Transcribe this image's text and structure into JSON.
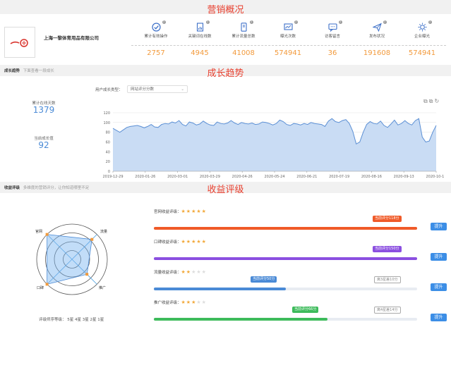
{
  "sections": {
    "overview_title": "营销概况",
    "growth_title": "成长趋势",
    "revenue_title": "收益评级"
  },
  "company": {
    "name": "上海一黎体育用品有限公司"
  },
  "stats": [
    {
      "label": "累计有效操作",
      "value": "2757",
      "icon": "check-circle-icon"
    },
    {
      "label": "关键词在线数",
      "value": "4945",
      "icon": "document-icon"
    },
    {
      "label": "累计流量总数",
      "value": "41008",
      "icon": "phone-icon"
    },
    {
      "label": "曝光次数",
      "value": "574941",
      "icon": "monitor-chart-icon"
    },
    {
      "label": "访客留言",
      "value": "36",
      "icon": "message-icon"
    },
    {
      "label": "发布状况",
      "value": "191608",
      "icon": "paper-plane-icon"
    },
    {
      "label": "企业曝光",
      "value": "574941",
      "icon": "sun-icon"
    }
  ],
  "growth": {
    "tab_label": "成长趋势",
    "tab_hint": "下面查看一段成长",
    "type_label": "用户成长类型：",
    "type_value": "网站评分分数",
    "cumulative_label": "累计在线天数",
    "cumulative_value": "1379",
    "current_label": "当前成长值",
    "current_value": "92"
  },
  "chart_data": {
    "type": "area",
    "x_ticks": [
      "2019-12-29",
      "2020-01-26",
      "2020-03-01",
      "2020-03-29",
      "2020-04-26",
      "2020-05-24",
      "2020-06-21",
      "2020-07-19",
      "2020-08-16",
      "2020-09-13",
      "2020-10-11"
    ],
    "y_ticks": [
      "0",
      "20",
      "40",
      "60",
      "80",
      "100",
      "120"
    ],
    "ylim": [
      0,
      120
    ],
    "grid": true,
    "color": "#5b8fd4",
    "fill": "#c9dcf4",
    "values": [
      88,
      84,
      80,
      85,
      90,
      92,
      93,
      94,
      92,
      89,
      92,
      96,
      91,
      90,
      96,
      98,
      97,
      101,
      99,
      104,
      96,
      93,
      101,
      99,
      95,
      97,
      103,
      98,
      95,
      94,
      101,
      98,
      97,
      99,
      104,
      99,
      96,
      100,
      98,
      97,
      99,
      96,
      97,
      101,
      100,
      98,
      95,
      98,
      105,
      102,
      96,
      94,
      98,
      97,
      95,
      98,
      96,
      100,
      98,
      97,
      96,
      92,
      103,
      108,
      102,
      100,
      104,
      106,
      98,
      82,
      56,
      60,
      80,
      96,
      102,
      98,
      97,
      103,
      94,
      90,
      97,
      105,
      95,
      98,
      104,
      98,
      95,
      104,
      108,
      70,
      60,
      62,
      80,
      94
    ]
  },
  "revenue": {
    "tab_label": "收益评级",
    "tab_hint": "多维度的营销评分，让你知道哪里不足",
    "radar_labels": [
      "官网",
      "流量",
      "推广",
      "口碑"
    ],
    "radar_values": [
      5,
      4,
      3,
      5
    ],
    "radar_axis_max": 5,
    "rating_levels_text": "评级师序等级：  5星 4星 3星 2星 1星",
    "items": [
      {
        "label": "官网收益评级：",
        "stars": 5,
        "current_tag": "当前评分118分",
        "current_pct": 1.0,
        "color": "#f05a28",
        "target_tag": "",
        "button": "提升"
      },
      {
        "label": "口碑收益评级：",
        "stars": 5,
        "current_tag": "当前评分150分",
        "current_pct": 1.0,
        "color": "#8b4fe0",
        "target_tag": "",
        "button": "提升"
      },
      {
        "label": "流量收益评级：",
        "stars": 2,
        "current_tag": "当前评分50分",
        "current_pct": 0.5,
        "color": "#4a8ad6",
        "target_tag": "离3星差10分",
        "button": "提升"
      },
      {
        "label": "推广收益评级：",
        "stars": 3,
        "current_tag": "当前评分66分",
        "current_pct": 0.66,
        "color": "#3dbb5b",
        "target_tag": "离4星差14分",
        "button": "提升"
      }
    ]
  }
}
